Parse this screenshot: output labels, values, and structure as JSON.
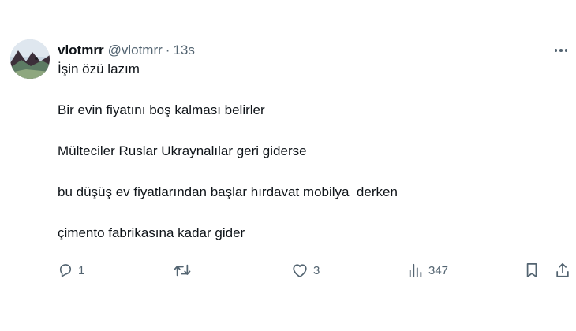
{
  "tweet": {
    "author": {
      "name": "vlotmrr",
      "handle": "@vlotmrr",
      "separator": "·",
      "time": "13s"
    },
    "lines": [
      "İşin özü lazım",
      "",
      "Bir evin fiyatını boş kalması belirler",
      "",
      "Mülteciler Ruslar Ukraynalılar geri giderse",
      "",
      "bu düşüş ev fiyatlarından başlar hırdavat mobilya  derken",
      "",
      "çimento fabrikasına kadar gider"
    ],
    "actions": {
      "reply_count": "1",
      "repost_count": "",
      "like_count": "3",
      "views_count": "347"
    },
    "icons": {
      "more": "more-horizontal-icon",
      "reply": "reply-icon",
      "repost": "repost-icon",
      "like": "heart-icon",
      "views": "views-icon",
      "bookmark": "bookmark-icon",
      "share": "share-icon"
    },
    "colors": {
      "text": "#0f1419",
      "secondary": "#536471",
      "background": "#ffffff"
    }
  }
}
